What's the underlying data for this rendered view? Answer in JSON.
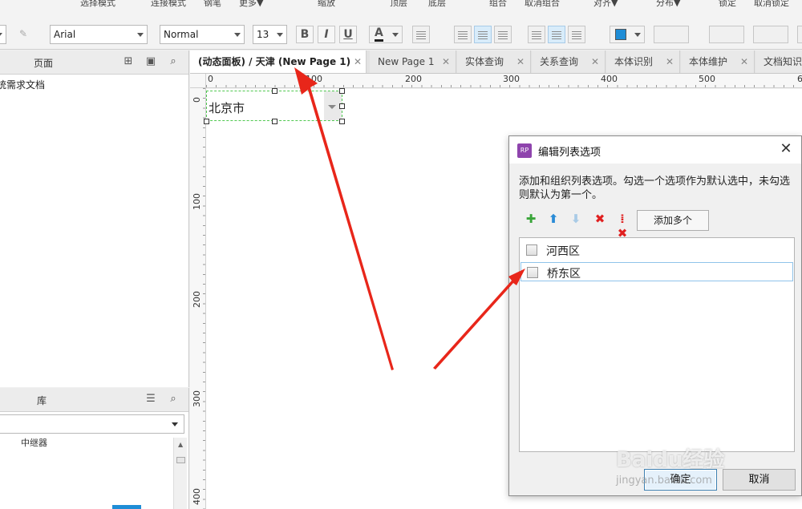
{
  "menu": {
    "items": [
      "选择模式",
      "连接模式",
      "钢笔",
      "更多▼",
      "缩放",
      "顶层",
      "底层",
      "组合",
      "取消组合",
      "对齐▼",
      "分布▼",
      "锁定",
      "取消锁定"
    ]
  },
  "toolbar": {
    "font_family": "Arial",
    "font_style": "Normal",
    "font_size": "13",
    "bold_label": "B",
    "italic_label": "I",
    "underline_label": "U",
    "text_color_label": "A",
    "fill_color": "#1f8dd6"
  },
  "pages_panel": {
    "title": "页面",
    "item": "统需求文档"
  },
  "library_panel": {
    "title": "库",
    "item": "中继器"
  },
  "tabs": [
    {
      "label": "(动态面板) / 天津 (New Page 1)",
      "active": true
    },
    {
      "label": "New Page 1",
      "active": false
    },
    {
      "label": "实体查询",
      "active": false
    },
    {
      "label": "关系查询",
      "active": false
    },
    {
      "label": "本体识别",
      "active": false
    },
    {
      "label": "本体维护",
      "active": false
    },
    {
      "label": "文档知识",
      "active": false
    }
  ],
  "ruler": {
    "top": [
      "0",
      "100",
      "200",
      "300",
      "400",
      "500",
      "6"
    ],
    "left": [
      "0",
      "100",
      "200",
      "300",
      "400"
    ]
  },
  "canvas": {
    "dropdown_value": "北京市"
  },
  "dialog": {
    "title": "编辑列表选项",
    "description": "添加和组织列表选项。勾选一个选项作为默认选中，未勾选则默认为第一个。",
    "add_multiple": "添加多个",
    "options": [
      {
        "label": "河西区",
        "checked": false
      },
      {
        "label": "桥东区",
        "checked": false
      }
    ],
    "ok": "确定",
    "cancel": "取消"
  },
  "watermark": {
    "main": "Baidu经验",
    "sub": "jingyan.baidu.com"
  },
  "colors": {
    "accent_arrow": "#e8261a",
    "selection_border": "#50c850",
    "dialog_icon": "#8e44ad"
  }
}
